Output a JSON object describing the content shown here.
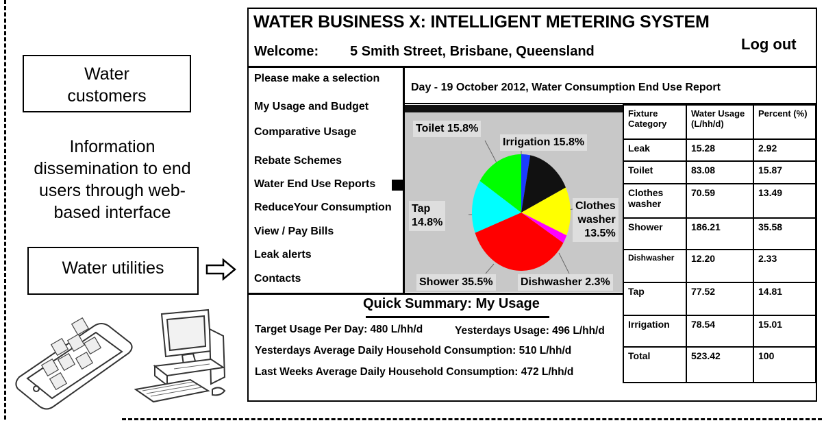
{
  "left_panel": {
    "customers_box": "Water\ncustomers",
    "info_text": "Information\ndissemination to end\nusers through web-\nbased interface",
    "utilities_box": "Water utilities"
  },
  "header": {
    "title": "WATER BUSINESS  X: INTELLIGENT METERING SYSTEM",
    "welcome_label": "Welcome:",
    "address": "5 Smith Street, Brisbane, Queensland",
    "logout": "Log out"
  },
  "menu": {
    "prompt": "Please make a selection",
    "items": [
      "My Usage and Budget",
      "Comparative Usage",
      "Rebate Schemes",
      "Water End Use Reports",
      "ReduceYour Consumption",
      "View / Pay Bills",
      "Leak alerts",
      "Contacts"
    ]
  },
  "report": {
    "title": "Day - 19 October 2012, Water Consumption End Use Report"
  },
  "chart_data": {
    "type": "pie",
    "slices": [
      {
        "name": "Leak",
        "value": 2.92,
        "color": "#1a3cff"
      },
      {
        "name": "Irrigation",
        "value": 15.01,
        "color": "#111111"
      },
      {
        "name": "Clothes washer",
        "value": 13.49,
        "color": "#ffff00"
      },
      {
        "name": "Dishwasher",
        "value": 2.33,
        "color": "#ff00ff"
      },
      {
        "name": "Shower",
        "value": 35.58,
        "color": "#ff0000"
      },
      {
        "name": "Tap",
        "value": 14.81,
        "color": "#00ffff"
      },
      {
        "name": "Toilet",
        "value": 15.87,
        "color": "#00ff00"
      }
    ],
    "labels": {
      "toilet": "Toilet 15.8%",
      "irrigation": "Irrigation 15.8%",
      "tap": "Tap\n14.8%",
      "clothes": "Clothes\nwasher\n13.5%",
      "shower": "Shower 35.5%",
      "dishwasher": "Dishwasher 2.3%"
    }
  },
  "table": {
    "headers": [
      "Fixture\nCategory",
      "Water Usage\n(L/hh/d)",
      "Percent (%)"
    ],
    "rows": [
      [
        "Leak",
        "15.28",
        "2.92"
      ],
      [
        "Toilet",
        "83.08",
        "15.87"
      ],
      [
        "Clothes\nwasher",
        "70.59",
        "13.49"
      ],
      [
        "Shower",
        "186.21",
        "35.58"
      ],
      [
        "Dishwasher",
        "12.20",
        "2.33"
      ],
      [
        "Tap",
        "77.52",
        "14.81"
      ],
      [
        "Irrigation",
        "78.54",
        "15.01"
      ],
      [
        "Total",
        "523.42",
        "100"
      ]
    ]
  },
  "summary": {
    "title": "Quick Summary: My Usage",
    "target": "Target Usage Per Day: 480 L/hh/d",
    "yesterday": "Yesterdays Usage: 496 L/hh/d",
    "avg_yesterday": "Yesterdays Average Daily Household Consumption: 510 L/hh/d",
    "avg_lastweek": "Last Weeks Average Daily Household Consumption: 472 L/hh/d"
  }
}
